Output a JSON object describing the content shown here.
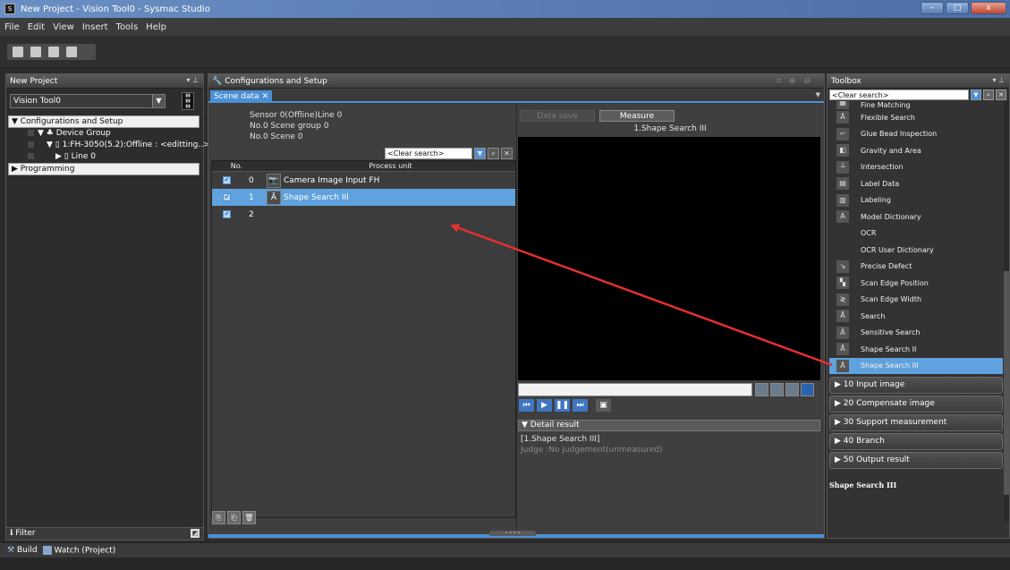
{
  "window": {
    "title": "New Project - Vision Tool0 - Sysmac Studio",
    "app_icon": "S"
  },
  "menu": [
    "File",
    "Edit",
    "View",
    "Insert",
    "Tools",
    "Help"
  ],
  "left_panel": {
    "title": "New Project",
    "pin": "▾ ⊥",
    "project_select": "Vision Tool0",
    "tree": {
      "config_header": "▼ Configurations and Setup",
      "device_group": "▼ ♣ Device Group",
      "controller": "▼ ▯ 1:FH-3050(5.2):Offline : <editting..>",
      "line": "▶ ▯ Line 0",
      "programming_header": "▶ Programming"
    },
    "filter_label": "Filter"
  },
  "center_panel": {
    "title": "Configurations and Setup",
    "tab_label": "Scene data",
    "scene_info": [
      "Sensor 0(Offline)Line 0",
      "No.0 Scene group 0",
      "No.0 Scene 0"
    ],
    "search_placeholder": "<Clear search>",
    "list_headers": {
      "no": "No.",
      "unit": "Process unit"
    },
    "units": [
      {
        "no": "0",
        "name": "Camera Image Input FH",
        "icon": "📷"
      },
      {
        "no": "1",
        "name": "Shape Search III",
        "icon": "Ā"
      },
      {
        "no": "2",
        "name": "",
        "icon": ""
      }
    ],
    "buttons": {
      "data_save": "Data save",
      "measure": "Measure"
    },
    "image_title": "1.Shape Search III",
    "detail": {
      "header": "▼ Detail result",
      "line1": "[1.Shape Search III]",
      "line2": "Judge :No judgement(unmeasured)"
    }
  },
  "toolbox": {
    "title": "Toolbox",
    "search_placeholder": "<Clear search>",
    "items": [
      {
        "label": "Fine Matching",
        "icon": "▦"
      },
      {
        "label": "Flexible Search",
        "icon": "Ā"
      },
      {
        "label": "Glue Bead Inspection",
        "icon": "⌐"
      },
      {
        "label": "Gravity and Area",
        "icon": "◧"
      },
      {
        "label": "Intersection",
        "icon": "┴"
      },
      {
        "label": "Label Data",
        "icon": "▤"
      },
      {
        "label": "Labeling",
        "icon": "▥"
      },
      {
        "label": "Model Dictionary",
        "icon": "A"
      },
      {
        "label": "OCR",
        "icon": ""
      },
      {
        "label": "OCR User Dictionary",
        "icon": ""
      },
      {
        "label": "Precise Defect",
        "icon": "↘"
      },
      {
        "label": "Scan Edge Position",
        "icon": "▚"
      },
      {
        "label": "Scan Edge Width",
        "icon": "≷"
      },
      {
        "label": "Search",
        "icon": "Ā"
      },
      {
        "label": "Sensitive Search",
        "icon": "Ã"
      },
      {
        "label": "Shape Search II",
        "icon": "Ā"
      },
      {
        "label": "Shape Search III",
        "icon": "Ā"
      }
    ],
    "categories": [
      "▶ 10 Input image",
      "▶ 20 Compensate image",
      "▶ 30 Support measurement",
      "▶ 40 Branch",
      "▶ 50 Output result"
    ],
    "selected_item": "Shape Search III"
  },
  "statusbar": {
    "build": "Build",
    "watch": "Watch (Project)"
  },
  "colors": {
    "accent": "#5fa2dd",
    "arrow": "#e53030"
  }
}
